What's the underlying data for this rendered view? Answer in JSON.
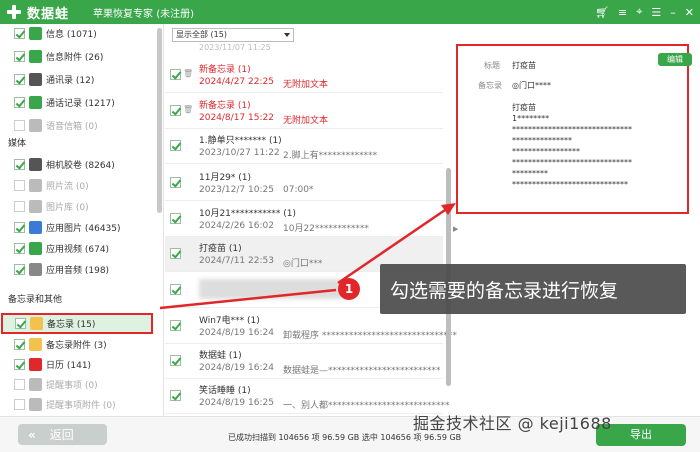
{
  "app": {
    "brand": "数据蛙",
    "title": "苹果恢复专家 (未注册)"
  },
  "sidebar": {
    "top_items": [
      {
        "label": "信息 (1071)",
        "checked": true,
        "color": "#3aa64a",
        "icon": "message-icon"
      },
      {
        "label": "信息附件 (26)",
        "checked": true,
        "color": "#3aa64a",
        "icon": "message-attachment-icon"
      },
      {
        "label": "通讯录 (12)",
        "checked": true,
        "color": "#555555",
        "icon": "contacts-icon"
      },
      {
        "label": "通话记录 (1217)",
        "checked": true,
        "color": "#3aa64a",
        "icon": "phone-icon"
      },
      {
        "label": "语音信箱 (0)",
        "checked": false,
        "color": "#bbbbbb",
        "icon": "voicemail-icon"
      }
    ],
    "media_title": "媒体",
    "media_items": [
      {
        "label": "相机胶卷 (8264)",
        "checked": true,
        "color": "#555555",
        "icon": "camera-icon"
      },
      {
        "label": "照片流 (0)",
        "checked": false,
        "color": "#bbbbbb",
        "icon": "photo-stream-icon"
      },
      {
        "label": "图片库 (0)",
        "checked": false,
        "color": "#bbbbbb",
        "icon": "photo-library-icon"
      },
      {
        "label": "应用图片 (46435)",
        "checked": true,
        "color": "#3a7bd5",
        "icon": "app-photo-icon"
      },
      {
        "label": "应用视频 (674)",
        "checked": true,
        "color": "#3aa64a",
        "icon": "app-video-icon"
      },
      {
        "label": "应用音频 (198)",
        "checked": true,
        "color": "#888888",
        "icon": "music-icon"
      }
    ],
    "memo_title": "备忘录和其他",
    "memo_items": [
      {
        "label": "备忘录 (15)",
        "checked": true,
        "color": "#f2c14e",
        "icon": "notes-icon",
        "selected": true
      },
      {
        "label": "备忘录附件 (3)",
        "checked": true,
        "color": "#f2c14e",
        "icon": "notes-attachment-icon"
      },
      {
        "label": "日历 (141)",
        "checked": true,
        "color": "#e0272a",
        "icon": "calendar-icon"
      },
      {
        "label": "提醒事项 (0)",
        "checked": false,
        "color": "#bbbbbb",
        "icon": "reminder-icon"
      },
      {
        "label": "提醒事项附件 (0)",
        "checked": false,
        "color": "#bbbbbb",
        "icon": "reminder-attachment-icon"
      }
    ]
  },
  "list": {
    "filter": "显示全部 (15)",
    "top_partial": "2023/11/07 11:25",
    "rows": [
      {
        "title": "新备忘录 (1)",
        "date": "2024/4/27 22:25",
        "preview": "无附加文本",
        "red": true,
        "trash": true
      },
      {
        "title": "新备忘录 (1)",
        "date": "2024/8/17 15:22",
        "preview": "无附加文本",
        "red": true,
        "trash": true
      },
      {
        "title": "1.静单只******* (1)",
        "date": "2023/10/27 11:22",
        "preview": "2.脚上有*************",
        "red": false,
        "trash": false
      },
      {
        "title": "11月29* (1)",
        "date": "2023/12/7 10:25",
        "preview": "07:00*",
        "red": false,
        "trash": false
      },
      {
        "title": "10月21*********** (1)",
        "date": "2024/2/26 16:02",
        "preview": "10月22************",
        "red": false,
        "trash": false
      },
      {
        "title": "打疫苗 (1)",
        "date": "2024/7/11 22:53",
        "preview": "◎门口***",
        "red": false,
        "trash": false,
        "highlight": true
      },
      {
        "title": "",
        "date": "",
        "preview": "",
        "red": false,
        "trash": false,
        "blurred": true
      },
      {
        "title": "Win7电*** (1)",
        "date": "2024/8/19 16:24",
        "preview": "卸载程序 ******************************",
        "red": false,
        "trash": false
      },
      {
        "title": "数据蛙 (1)",
        "date": "2024/8/19 16:24",
        "preview": "数据蛙是—*************************",
        "red": false,
        "trash": false
      },
      {
        "title": "笑话睡睡 (1)",
        "date": "2024/8/19 16:25",
        "preview": "一、别人都***************************",
        "red": false,
        "trash": false
      }
    ]
  },
  "detail": {
    "edit_label": "编辑",
    "title_label": "标题",
    "title_value": "打疫苗",
    "memo_label": "备忘录",
    "memo_value": "◎门口****",
    "body": "打疫苗\n1********\n******************************\n***************\n*****************\n******************************\n*********\n*****************************"
  },
  "bottom": {
    "back_label": "返回",
    "status": "已成功扫描到 104656 项 96.59 GB   选中 104656 项 96.59 GB",
    "export_label": "导出"
  },
  "callout": {
    "number": "1",
    "text": "勾选需要的备忘录进行恢复"
  },
  "watermark": "掘金技术社区 @ keji1688"
}
